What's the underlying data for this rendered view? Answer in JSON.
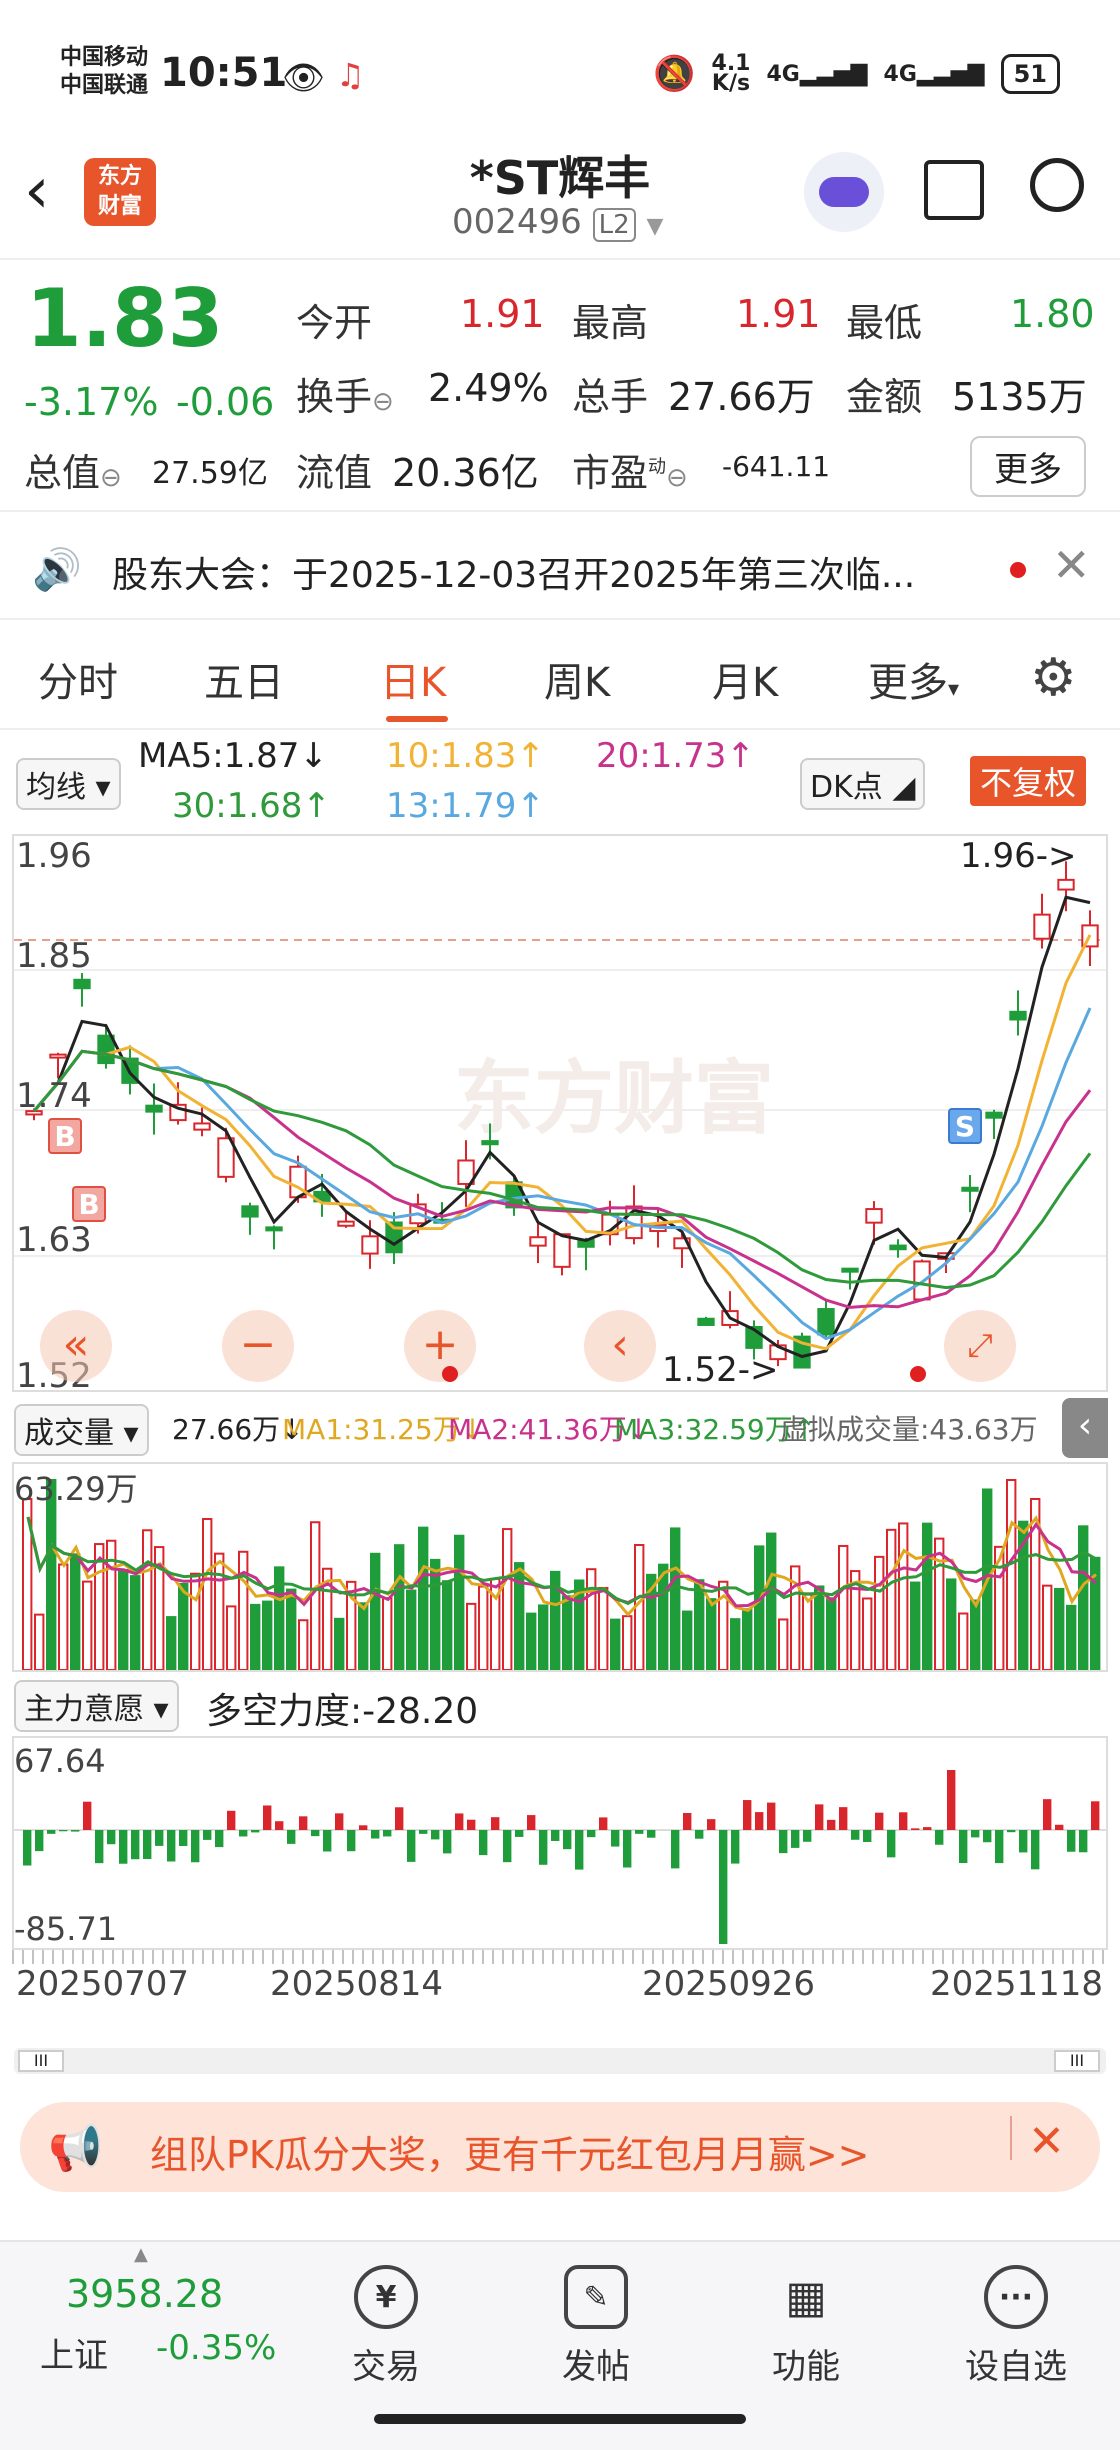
{
  "status": {
    "carrier1": "中国移动",
    "carrier2": "中国联通",
    "time": "10:51",
    "net_speed_top": "4.1",
    "net_speed_bottom": "K/s",
    "battery": "51"
  },
  "header": {
    "logo_line1": "东方",
    "logo_line2": "财富",
    "stock_name": "*ST辉丰",
    "stock_code": "002496",
    "level_badge": "L2"
  },
  "quote": {
    "price": "1.83",
    "change_pct": "-3.17%",
    "change": "-0.06",
    "open_label": "今开",
    "open": "1.91",
    "high_label": "最高",
    "high": "1.91",
    "low_label": "最低",
    "low": "1.80",
    "turnover_label": "换手",
    "turnover": "2.49%",
    "volume_label": "总手",
    "volume": "27.66万",
    "amount_label": "金额",
    "amount": "5135万",
    "mktcap_label": "总值",
    "mktcap": "27.59亿",
    "float_label": "流值",
    "float": "20.36亿",
    "pe_label": "市盈",
    "pe_sup": "动",
    "pe": "-641.11",
    "more": "更多"
  },
  "notice": {
    "text": "股东大会：于2025-12-03召开2025年第三次临..."
  },
  "tabs": [
    "分时",
    "五日",
    "日K",
    "周K",
    "月K",
    "更多"
  ],
  "active_tab": 2,
  "ma": {
    "selector": "均线",
    "ma5": "MA5:1.87↓",
    "ma10": "10:1.83↑",
    "ma20": "20:1.73↑",
    "ma30": "30:1.68↑",
    "ma13": "13:1.79↑",
    "dk": "DK点",
    "fq": "不复权",
    "colors": {
      "ma5": "#222222",
      "ma10": "#f2b233",
      "ma20": "#c8328c",
      "ma30": "#2e9a3a",
      "ma13": "#59a8e0",
      "up": "#d9262c",
      "down": "#1f9d3a"
    }
  },
  "kchart": {
    "y_top": "1.96",
    "y_2": "1.85",
    "y_3": "1.74",
    "y_4": "1.63",
    "y_bottom": "1.52",
    "max_marker": "1.96->",
    "min_marker": "1.52->",
    "watermark": "东方财富",
    "buy_mark": "B",
    "sell_mark": "S"
  },
  "volume": {
    "selector": "成交量",
    "vol": "27.66万↓",
    "ma1": "MA1:31.25万↓",
    "ma2": "MA2:41.36万↓",
    "ma3": "MA3:32.59万↑",
    "virtual": "虚拟成交量:43.63万",
    "y_top": "63.29万"
  },
  "flow": {
    "selector": "主力意愿",
    "power": "多空力度:-28.20",
    "y_top": "67.64",
    "y_bottom": "-85.71"
  },
  "dates": [
    "20250707",
    "20250814",
    "20250926",
    "20251118"
  ],
  "banner": {
    "text": "组队PK瓜分大奖，更有千元红包月月赢>>"
  },
  "bottom": {
    "index_value": "3958.28",
    "index_name": "上证",
    "index_change": "-0.35%",
    "nav": [
      "交易",
      "发帖",
      "功能",
      "设自选"
    ]
  }
}
